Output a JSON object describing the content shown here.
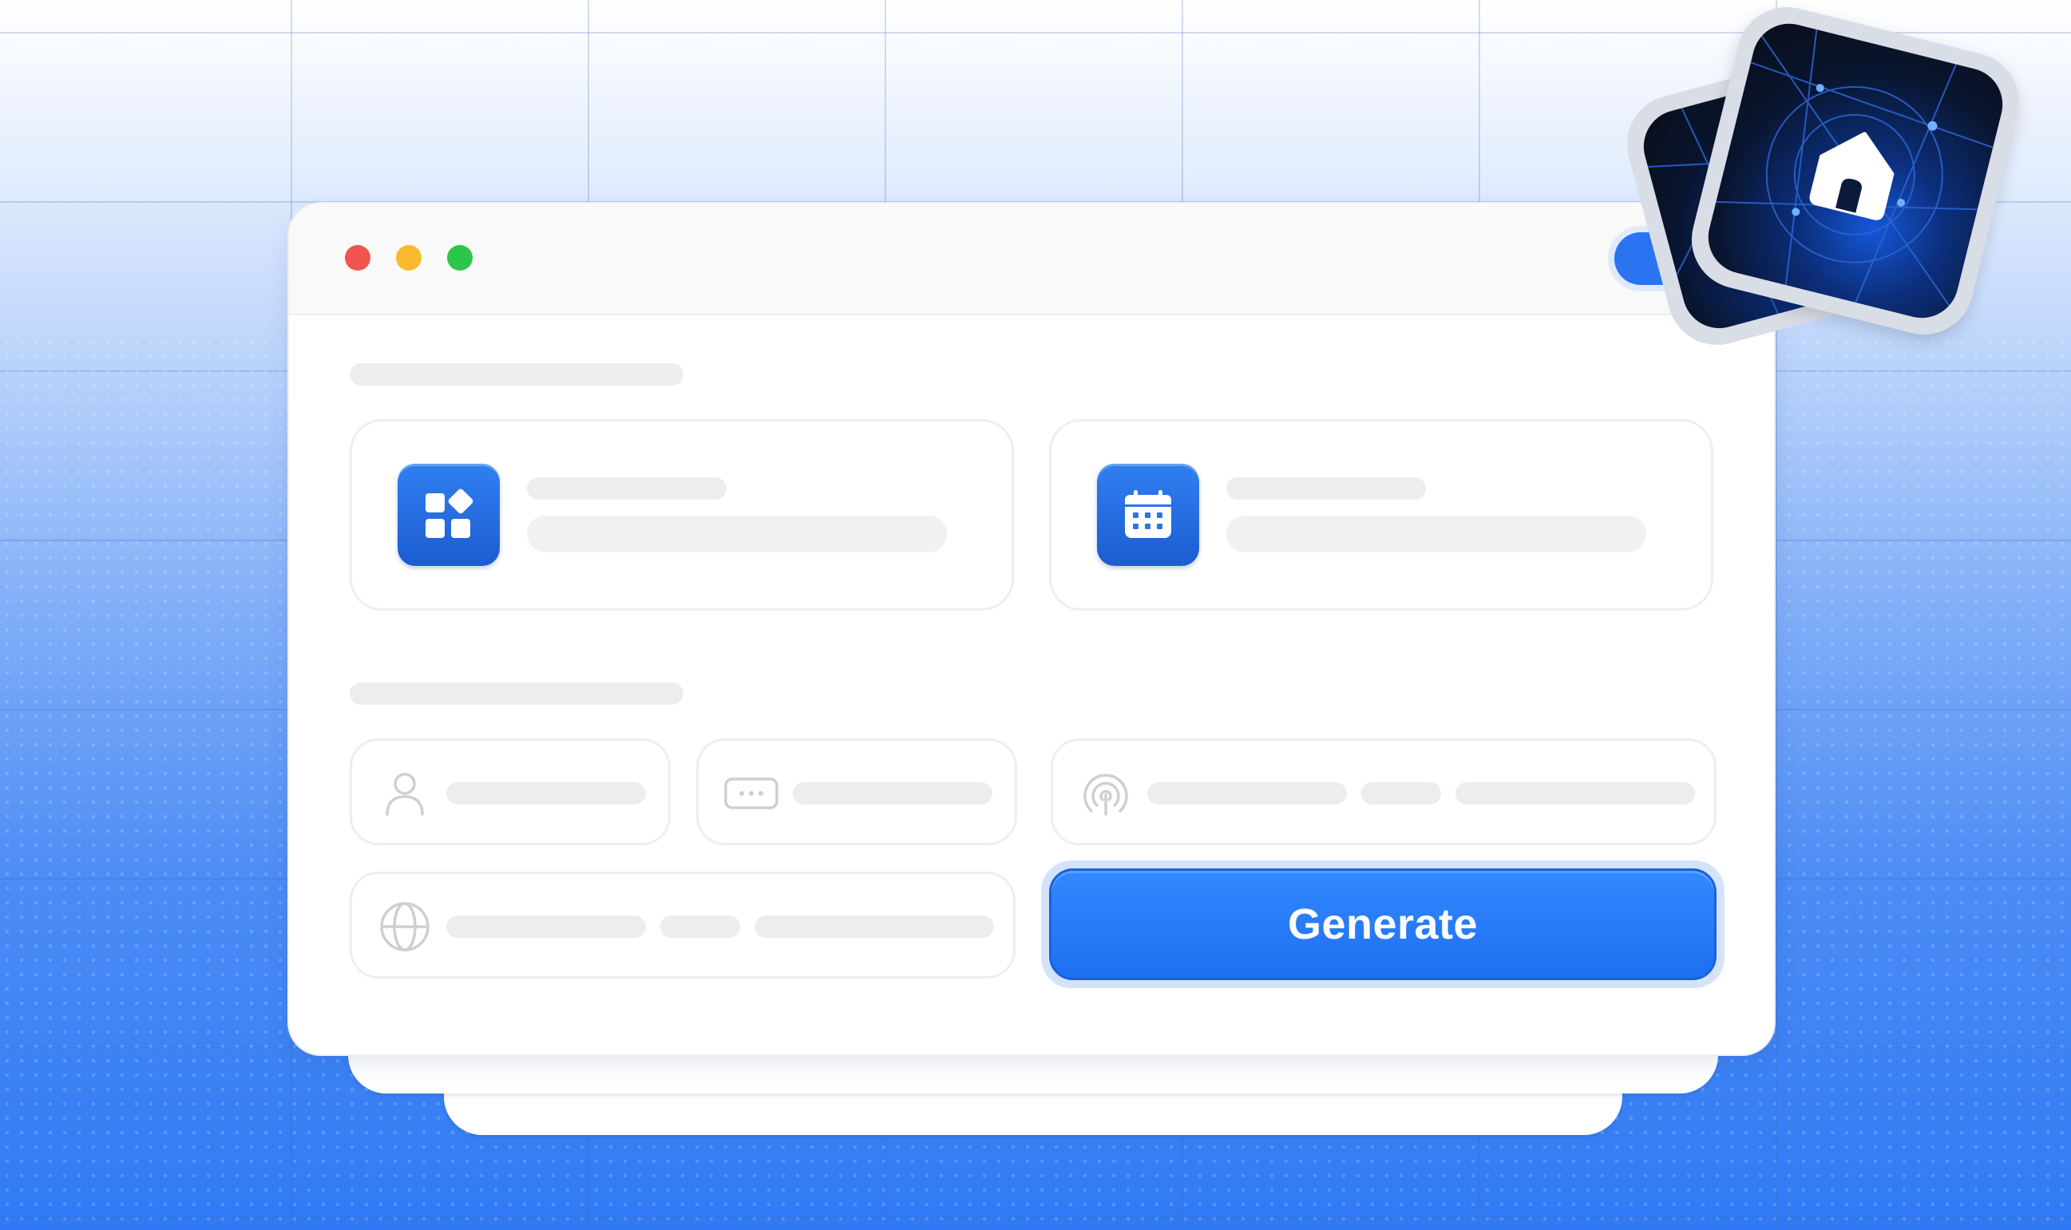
{
  "window": {
    "traffic_lights": {
      "red": "#f25450",
      "yellow": "#f9bb2d",
      "green": "#2cc64a"
    }
  },
  "cards": [
    {
      "icon": "app-grid-icon"
    },
    {
      "icon": "calendar-icon"
    }
  ],
  "fields": [
    {
      "icon": "user-icon"
    },
    {
      "icon": "password-dots-icon"
    },
    {
      "icon": "airdrop-signal-icon"
    },
    {
      "icon": "globe-icon"
    }
  ],
  "generate": {
    "label": "Generate"
  },
  "badge": {
    "icon": "home-icon"
  },
  "colors": {
    "accent": "#2a74f2",
    "background_bottom": "#2f7af4"
  }
}
